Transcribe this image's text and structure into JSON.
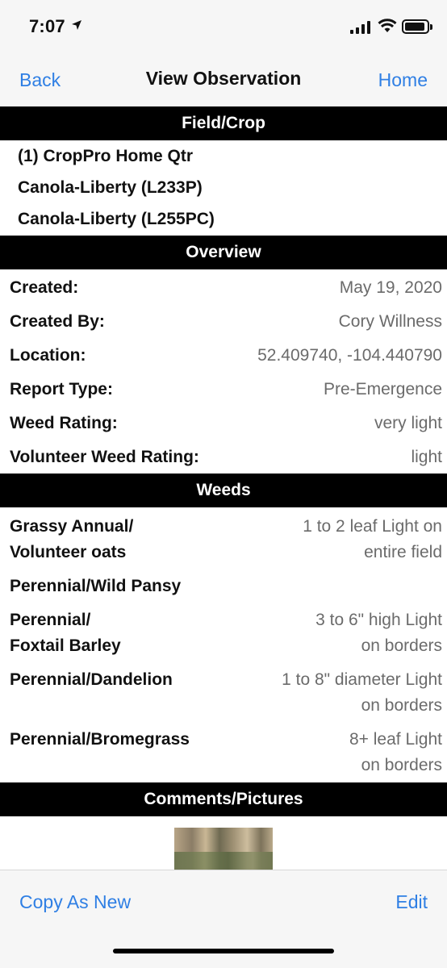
{
  "status_bar": {
    "time": "7:07"
  },
  "nav": {
    "back_label": "Back",
    "title": "View Observation",
    "home_label": "Home"
  },
  "field_crop": {
    "header": "Field/Crop",
    "lines": [
      "(1) CropPro Home Qtr",
      "Canola-Liberty (L233P)",
      "Canola-Liberty (L255PC)"
    ]
  },
  "overview": {
    "header": "Overview",
    "rows": [
      {
        "label": "Created:",
        "value": "May 19, 2020"
      },
      {
        "label": "Created By:",
        "value": "Cory Willness"
      },
      {
        "label": "Location:",
        "value": "52.409740, -104.440790"
      },
      {
        "label": "Report Type:",
        "value": "Pre-Emergence"
      },
      {
        "label": "Weed Rating:",
        "value": "very light"
      },
      {
        "label": "Volunteer Weed Rating:",
        "value": "light"
      }
    ]
  },
  "weeds": {
    "header": "Weeds",
    "rows": [
      {
        "label_1": "Grassy Annual/",
        "label_2": "Volunteer oats",
        "value_1": "1 to 2 leaf Light on",
        "value_2": "entire field"
      },
      {
        "label_1": "Perennial/Wild Pansy",
        "label_2": "",
        "value_1": "",
        "value_2": ""
      },
      {
        "label_1": "Perennial/",
        "label_2": "Foxtail Barley",
        "value_1": "3 to 6\" high Light",
        "value_2": "on borders"
      },
      {
        "label_1": "Perennial/Dandelion",
        "label_2": "",
        "value_1": "1 to 8\" diameter Light",
        "value_2": "on borders"
      },
      {
        "label_1": "Perennial/Bromegrass",
        "label_2": "",
        "value_1": "8+ leaf Light",
        "value_2": "on borders"
      }
    ]
  },
  "comments": {
    "header": "Comments/Pictures"
  },
  "toolbar": {
    "copy_label": "Copy As New",
    "edit_label": "Edit"
  },
  "colors": {
    "accent": "#2f7fe4",
    "header_bg": "#000000",
    "value_text": "#6b6b6b"
  }
}
